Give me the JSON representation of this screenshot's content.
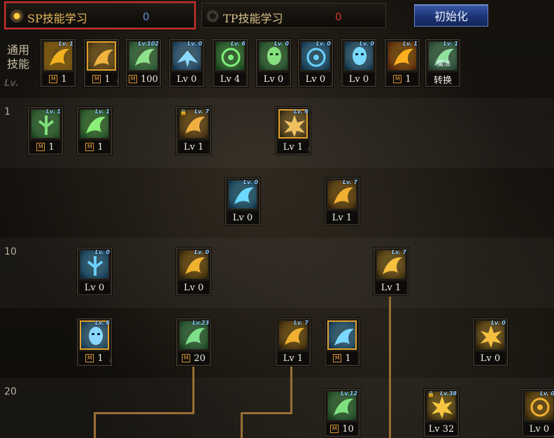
{
  "tabs": {
    "sp": {
      "label": "SP技能学习",
      "value": "0"
    },
    "tp": {
      "label": "TP技能学习",
      "value": "0"
    }
  },
  "init_button": "初始化",
  "common_label": "通用技能",
  "lv_watermark": "Lv.",
  "row_labels": [
    "1",
    "10",
    "20"
  ],
  "colors": {
    "highlight": "#d42a2a",
    "sp_value": "#5d8fd6",
    "tp_value": "#d03a2a",
    "accent": "#e0a02c"
  },
  "common_skills": [
    {
      "name": "stun-skill-icon",
      "top": "Lv. 1",
      "bottom": "1",
      "mastery": true
    },
    {
      "name": "kneel-skill-icon",
      "top": "",
      "bottom": "1",
      "mastery": true,
      "highlight": true,
      "clock": true
    },
    {
      "name": "rush-skill-icon",
      "top": "Lv.102",
      "bottom": "100",
      "mastery": true
    },
    {
      "name": "wings-skill-icon",
      "top": "Lv. 0",
      "bottom": "Lv 0",
      "mastery": false
    },
    {
      "name": "crosshair-skill-icon",
      "top": "Lv. 6",
      "bottom": "Lv 4",
      "mastery": false
    },
    {
      "name": "ghost-skill-icon",
      "top": "Lv. 0",
      "bottom": "Lv 0",
      "mastery": false
    },
    {
      "name": "eye-skill-icon",
      "top": "Lv. 0",
      "bottom": "Lv 0",
      "mastery": false
    },
    {
      "name": "armor-skill-icon",
      "top": "Lv. 0",
      "bottom": "Lv 0",
      "mastery": false
    },
    {
      "name": "fire-skill-icon",
      "top": "Lv. 1",
      "bottom": "1",
      "mastery": true
    },
    {
      "name": "magic-convert-skill-icon",
      "top": "Lv. 1",
      "bottom": "转换",
      "mastery": false,
      "icon_text": "魔法"
    }
  ],
  "tree_skills": [
    {
      "name": "cross-skill-icon",
      "top": "Lv. 1",
      "bottom": "1",
      "mastery": true
    },
    {
      "name": "basic-skill-icon",
      "top": "Lv. 1",
      "bottom": "1",
      "mastery": true
    },
    {
      "name": "slash-skill-icon",
      "top": "Lv. 7",
      "bottom": "Lv 1",
      "mastery": false,
      "lock": true
    },
    {
      "name": "burst-skill-icon",
      "top": "Lv. 6",
      "bottom": "Lv 1",
      "mastery": false,
      "highlight": true,
      "clock": true
    },
    {
      "name": "blue-wave-skill-icon",
      "top": "Lv. 0",
      "bottom": "Lv 0",
      "mastery": false
    },
    {
      "name": "flame-strike-skill-icon",
      "top": "Lv. 7",
      "bottom": "Lv 1",
      "mastery": false
    },
    {
      "name": "trident-skill-icon",
      "top": "Lv. 0",
      "bottom": "Lv 0",
      "mastery": false
    },
    {
      "name": "claw-skill-icon",
      "top": "Lv. 0",
      "bottom": "Lv 0",
      "mastery": false
    },
    {
      "name": "beast-skill-icon",
      "top": "Lv. 7",
      "bottom": "Lv 1",
      "mastery": false
    },
    {
      "name": "mask-skill-icon",
      "top": "Lv. 6",
      "bottom": "1",
      "mastery": true,
      "highlight": true,
      "clock": true
    },
    {
      "name": "green-slash-skill-icon",
      "top": "Lv.23",
      "bottom": "20",
      "mastery": true
    },
    {
      "name": "fang-skill-icon",
      "top": "Lv. 7",
      "bottom": "Lv 1",
      "mastery": false
    },
    {
      "name": "ice-shard-skill-icon",
      "top": "",
      "bottom": "1",
      "mastery": true,
      "highlight": true
    },
    {
      "name": "spike-skill-icon",
      "top": "Lv. 0",
      "bottom": "Lv 0",
      "mastery": false
    },
    {
      "name": "bow-skill-icon",
      "top": "Lv.12",
      "bottom": "10",
      "mastery": true
    },
    {
      "name": "explosion-skill-icon",
      "top": "Lv.38",
      "bottom": "Lv 32",
      "mastery": false,
      "lock": true
    },
    {
      "name": "vortex-skill-icon",
      "top": "Lv. 0",
      "bottom": "Lv 0",
      "mastery": false
    }
  ]
}
